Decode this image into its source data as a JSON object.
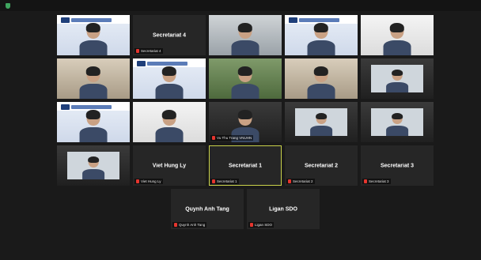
{
  "window": {
    "title": "",
    "accent_color": "#c9d24a",
    "muted_color": "#e5352e"
  },
  "rows": [
    [
      {
        "type": "video",
        "bg": "banner",
        "name": ""
      },
      {
        "type": "name",
        "display": "Secretariat 4",
        "name": "Secretariat 4"
      },
      {
        "type": "video",
        "bg": "office",
        "name": ""
      },
      {
        "type": "video",
        "bg": "banner",
        "name": ""
      },
      {
        "type": "video",
        "bg": "white",
        "name": ""
      }
    ],
    [
      {
        "type": "video",
        "bg": "room",
        "name": ""
      },
      {
        "type": "video",
        "bg": "banner",
        "name": ""
      },
      {
        "type": "video",
        "bg": "green",
        "name": ""
      },
      {
        "type": "video",
        "bg": "room",
        "name": ""
      },
      {
        "type": "video",
        "bg": "inset",
        "name": ""
      }
    ],
    [
      {
        "type": "video",
        "bg": "banner",
        "name": ""
      },
      {
        "type": "video",
        "bg": "white",
        "name": ""
      },
      {
        "type": "video",
        "bg": "dark",
        "name": "Vu Thu Trang VNUHN",
        "speaking": true
      },
      {
        "type": "video",
        "bg": "inset",
        "name": ""
      },
      {
        "type": "video",
        "bg": "inset",
        "name": ""
      }
    ],
    [
      {
        "type": "video",
        "bg": "inset",
        "name": ""
      },
      {
        "type": "name",
        "display": "Viet Hung Ly",
        "name": "Viet Hung Ly"
      },
      {
        "type": "name",
        "display": "Secretariat 1",
        "name": "Secretariat 1",
        "speaking": true
      },
      {
        "type": "name",
        "display": "Secretariat 2",
        "name": "Secretariat 2"
      },
      {
        "type": "name",
        "display": "Secretariat 3",
        "name": "Secretariat 3"
      }
    ],
    [
      {
        "type": "name",
        "display": "Quynh Anh Tang",
        "name": "Quynh Anh Tang"
      },
      {
        "type": "name",
        "display": "Ligan SDO",
        "name": "Ligan SDO"
      }
    ]
  ]
}
